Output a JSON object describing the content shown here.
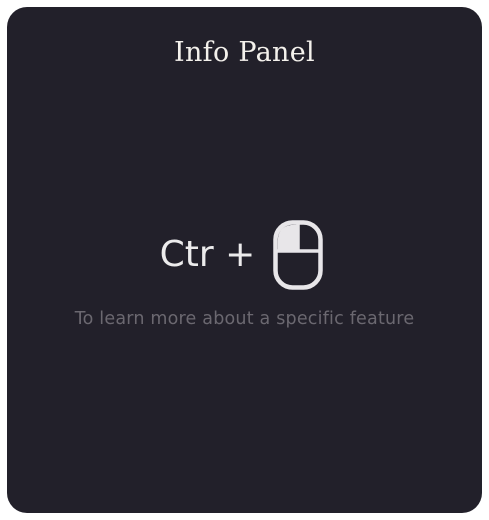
{
  "panel": {
    "title": "Info Panel",
    "shortcut_text": "Ctr +",
    "shortcut_icon": "mouse-left-click-icon",
    "hint": "To learn more about a specific feature"
  },
  "colors": {
    "panel_background": "#22202a",
    "title_text": "#f4f1ec",
    "shortcut_text": "#ecebec",
    "hint_text": "#6b6870"
  }
}
